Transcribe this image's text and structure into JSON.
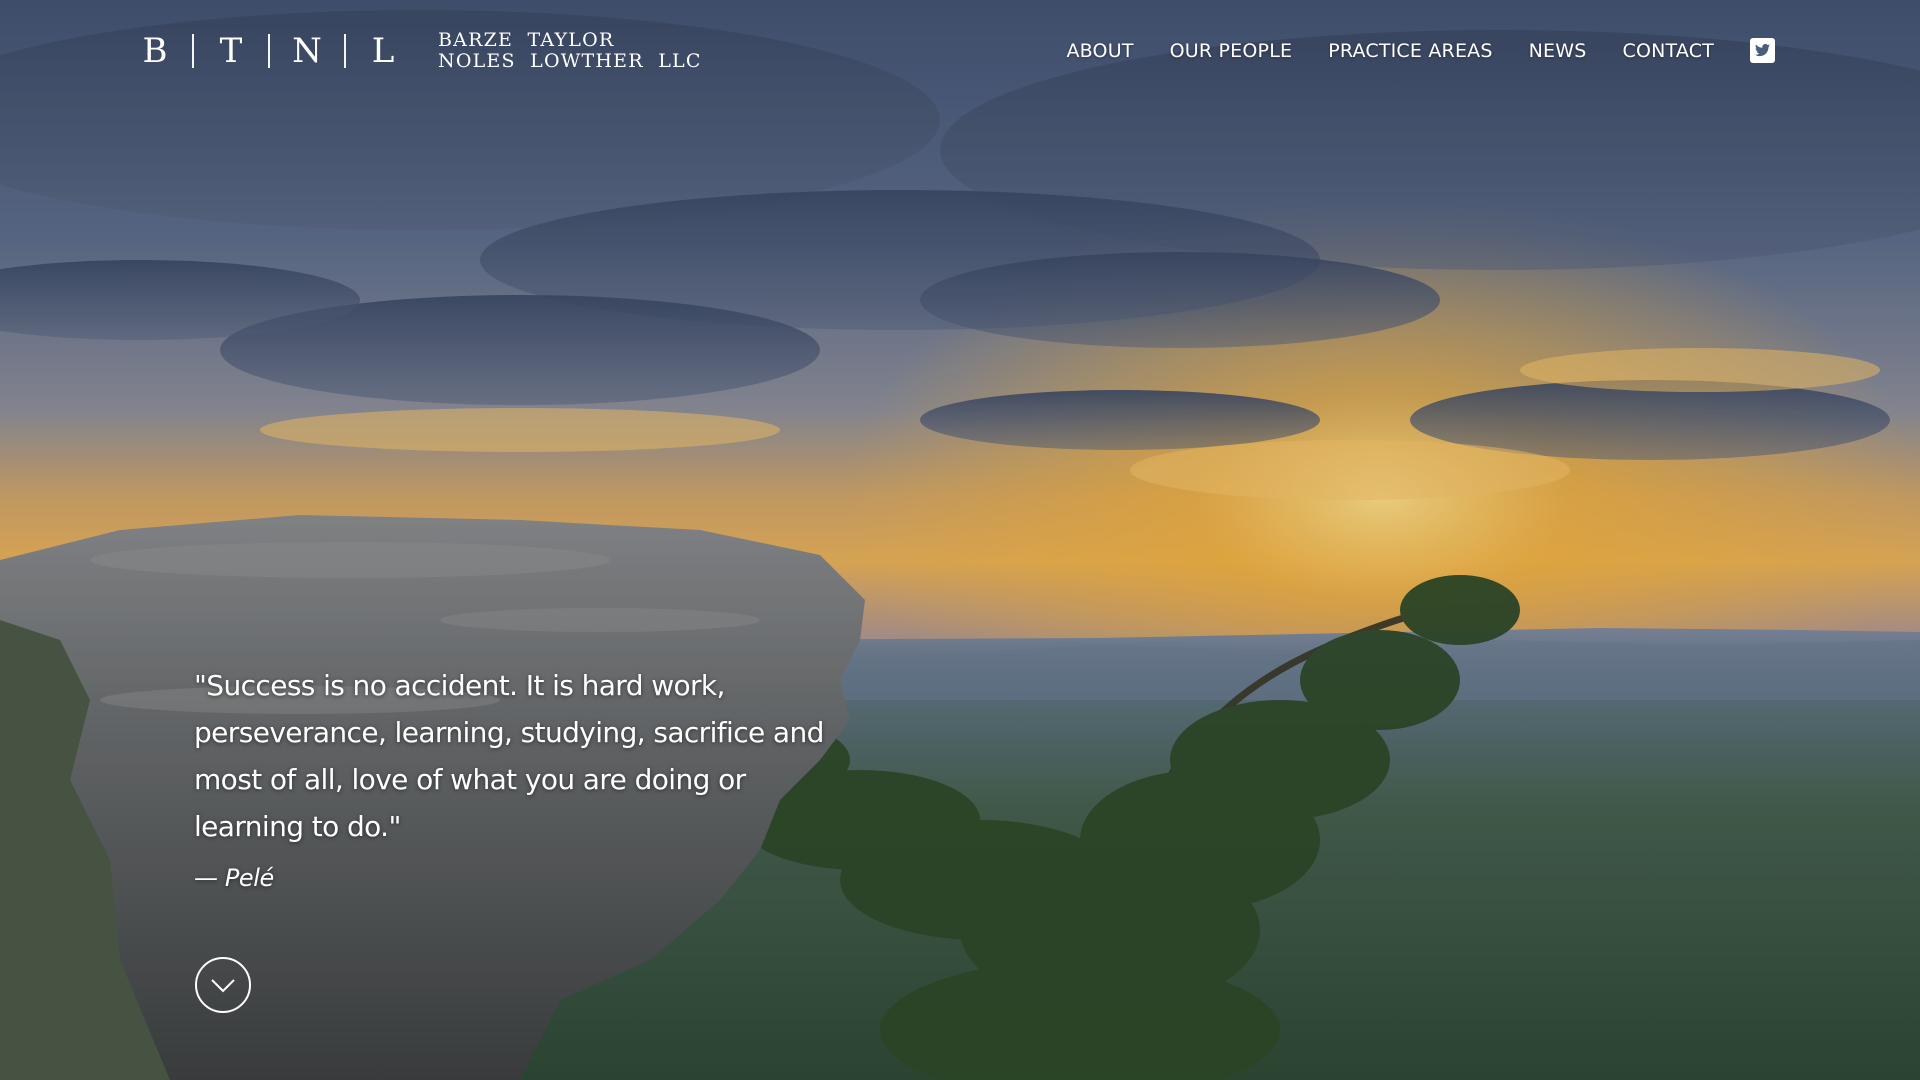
{
  "brand": {
    "mark_letters": [
      "B",
      "T",
      "N",
      "L"
    ],
    "name_line1": "BARZE  TAYLOR",
    "name_line2": "NOLES  LOWTHER  LLC"
  },
  "nav": {
    "items": [
      "ABOUT",
      "OUR PEOPLE",
      "PRACTICE AREAS",
      "NEWS",
      "CONTACT"
    ],
    "social_icon": "twitter-icon"
  },
  "hero": {
    "quote": "\"Success is no accident. It is hard work, perseverance, learning, studying, sacrifice and most of all, love of what you are doing or learning to do.\"",
    "author": "— Pelé",
    "scroll_icon": "chevron-down-icon"
  },
  "colors": {
    "text": "#ffffff",
    "sky_top": "#4f5f80",
    "sunset": "#f2b640",
    "forest": "#3d5a4a"
  }
}
